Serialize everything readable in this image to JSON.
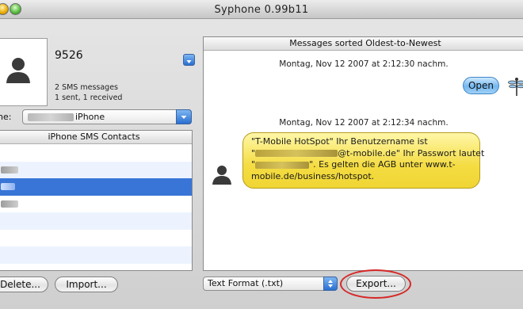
{
  "window": {
    "title": "Syphone 0.99b11"
  },
  "contact": {
    "name": "9526",
    "sms_count": "2 SMS messages",
    "sms_breakdown": "1 sent, 1 received"
  },
  "phone": {
    "label": "ne:",
    "selected": "iPhone"
  },
  "contacts_list": {
    "header": "iPhone SMS Contacts",
    "selected_index": 3
  },
  "buttons": {
    "delete": "Delete...",
    "import": "Import...",
    "export": "Export..."
  },
  "messages": {
    "header": "Messages sorted Oldest-to-Newest",
    "items": [
      {
        "timestamp": "Montag, Nov 12 2007 at 2:12:30 nachm.",
        "direction": "sent",
        "text": "Open"
      },
      {
        "timestamp": "Montag, Nov 12 2007 at 2:12:34 nachm.",
        "direction": "received",
        "line1": "\"T-Mobile HotSpot\" Ihr Benutzername ist",
        "line2_pre": "\"",
        "line2_post": "@t-mobile.de\" Ihr Passwort lautet",
        "line3_pre": "\"",
        "line3_post": "\". Es gelten die AGB unter www.t-",
        "line4": "mobile.de/business/hotspot."
      }
    ]
  },
  "export": {
    "format": "Text Format (.txt)"
  },
  "colors": {
    "selection": "#3875d7",
    "highlight_circle": "#d62828",
    "sms_bubble": "#f4dc42",
    "sent_bubble": "#74b7ef"
  }
}
